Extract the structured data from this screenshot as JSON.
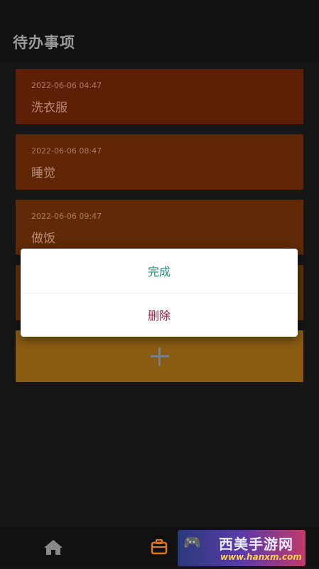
{
  "header": {
    "title": "待办事项"
  },
  "todos": [
    {
      "time": "2022-06-06 04:47",
      "task": "洗衣服",
      "color": "#5e1f06"
    },
    {
      "time": "2022-06-06 08:47",
      "task": "睡觉",
      "color": "#5f2505"
    },
    {
      "time": "2022-06-06 09:47",
      "task": "做饭",
      "color": "#5f2a05"
    },
    {
      "time": "",
      "task": "",
      "color": "#5f3106"
    }
  ],
  "dialog": {
    "done_label": "完成",
    "delete_label": "删除"
  },
  "watermark": {
    "brand": "西美手游网",
    "url": "www.hanxm.com"
  }
}
